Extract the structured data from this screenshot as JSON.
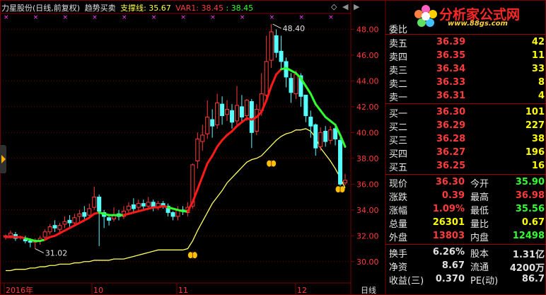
{
  "header": {
    "stock_name": "力星股份(日线,前复权)",
    "indicator_name": "趋势买卖",
    "support_label": "支撑线: 35.67",
    "var1_label": "VAR1: 38.45",
    "var2_label": ": 38.45"
  },
  "controls": {
    "diamond": "◇",
    "left_arrow": "◀",
    "right_arrow": "▶",
    "tab_label": "委比"
  },
  "logo": {
    "title": "分析家公式网",
    "url": "www.88gs.com"
  },
  "price_axis": {
    "ticks": [
      "48.00",
      "46.00",
      "44.00",
      "42.00",
      "40.00",
      "38.00",
      "36.00",
      "34.00",
      "32.00",
      "30.00"
    ],
    "values": [
      48,
      46,
      44,
      42,
      40,
      38,
      36,
      34,
      32,
      30
    ]
  },
  "date_axis": {
    "labels": [
      "2016年",
      "10",
      "11",
      "12"
    ],
    "period_label": "日线"
  },
  "annotations": {
    "high_label": "48.40",
    "low_label": "31.02"
  },
  "chart_data": {
    "type": "candlestick",
    "ylim": [
      29,
      49.5
    ],
    "candles": [
      [
        31.9,
        32.0,
        31.7,
        32.1
      ],
      [
        32.0,
        32.2,
        31.8,
        32.4
      ],
      [
        32.1,
        31.8,
        31.6,
        32.3
      ],
      [
        31.9,
        31.9,
        31.7,
        32.0
      ],
      [
        31.8,
        31.6,
        31.4,
        32.0
      ],
      [
        31.6,
        31.5,
        31.1,
        31.7
      ],
      [
        31.5,
        31.6,
        31.0,
        31.8
      ],
      [
        31.6,
        31.8,
        31.3,
        32.0
      ],
      [
        31.9,
        32.3,
        31.8,
        32.5
      ],
      [
        32.3,
        32.7,
        32.1,
        32.9
      ],
      [
        32.8,
        32.6,
        32.3,
        33.2
      ],
      [
        32.5,
        32.8,
        32.3,
        33.0
      ],
      [
        32.9,
        33.1,
        32.6,
        33.5
      ],
      [
        33.2,
        33.0,
        32.7,
        33.6
      ],
      [
        33.0,
        33.4,
        32.8,
        33.7
      ],
      [
        33.5,
        33.7,
        33.1,
        34.0
      ],
      [
        33.8,
        33.5,
        33.2,
        34.3
      ],
      [
        33.6,
        34.1,
        33.4,
        34.5
      ],
      [
        34.2,
        35.0,
        34.0,
        35.8
      ],
      [
        35.0,
        33.9,
        31.2,
        35.2
      ],
      [
        33.8,
        33.5,
        32.6,
        34.0
      ],
      [
        33.4,
        33.2,
        32.8,
        33.7
      ],
      [
        33.3,
        33.6,
        33.1,
        34.2
      ],
      [
        33.7,
        33.5,
        33.2,
        34.0
      ],
      [
        33.5,
        33.9,
        33.3,
        34.3
      ],
      [
        34.0,
        34.3,
        33.8,
        34.6
      ],
      [
        34.4,
        34.1,
        33.8,
        34.9
      ],
      [
        34.2,
        34.5,
        33.9,
        34.8
      ],
      [
        34.5,
        34.3,
        34.0,
        34.8
      ],
      [
        34.3,
        34.6,
        34.0,
        35.0
      ],
      [
        34.6,
        34.2,
        33.9,
        34.8
      ],
      [
        34.2,
        34.5,
        34.0,
        34.7
      ],
      [
        34.5,
        34.3,
        34.1,
        34.7
      ],
      [
        34.3,
        33.8,
        33.5,
        34.5
      ],
      [
        33.8,
        33.5,
        33.2,
        33.9
      ],
      [
        33.5,
        34.0,
        33.2,
        34.3
      ],
      [
        34.0,
        33.9,
        33.6,
        34.3
      ],
      [
        33.8,
        34.2,
        33.5,
        34.6
      ],
      [
        34.3,
        37.5,
        34.1,
        37.6
      ],
      [
        37.8,
        39.5,
        37.2,
        40.0
      ],
      [
        39.3,
        39.8,
        38.6,
        40.6
      ],
      [
        39.9,
        41.2,
        39.5,
        42.5
      ],
      [
        41.0,
        40.5,
        39.6,
        41.8
      ],
      [
        40.6,
        42.3,
        40.3,
        43.0
      ],
      [
        42.2,
        41.3,
        40.6,
        42.8
      ],
      [
        41.4,
        41.8,
        40.9,
        42.5
      ],
      [
        41.7,
        40.8,
        40.3,
        42.2
      ],
      [
        40.9,
        42.1,
        40.5,
        43.6
      ],
      [
        42.0,
        41.2,
        40.8,
        42.9
      ],
      [
        41.3,
        42.5,
        40.9,
        42.6
      ],
      [
        42.4,
        40.0,
        38.8,
        42.6
      ],
      [
        40.1,
        41.8,
        39.8,
        42.2
      ],
      [
        41.7,
        43.0,
        41.3,
        44.6
      ],
      [
        42.9,
        45.5,
        42.5,
        47.5
      ],
      [
        45.6,
        47.8,
        45.0,
        48.4
      ],
      [
        47.5,
        46.2,
        45.8,
        48.0
      ],
      [
        46.3,
        45.5,
        44.9,
        47.5
      ],
      [
        45.5,
        44.3,
        43.5,
        45.8
      ],
      [
        44.2,
        43.1,
        42.3,
        44.6
      ],
      [
        43.0,
        44.5,
        42.6,
        44.8
      ],
      [
        44.4,
        42.8,
        42.0,
        44.6
      ],
      [
        42.9,
        41.3,
        40.8,
        42.8
      ],
      [
        41.2,
        40.5,
        39.6,
        41.7
      ],
      [
        40.6,
        38.8,
        38.2,
        40.7
      ],
      [
        38.9,
        40.0,
        38.6,
        40.4
      ],
      [
        40.1,
        39.3,
        38.9,
        40.5
      ],
      [
        39.4,
        40.2,
        39.1,
        40.5
      ],
      [
        40.3,
        39.5,
        39.0,
        40.7
      ],
      [
        39.4,
        36.0,
        35.6,
        39.6
      ],
      [
        36.1,
        36.3,
        35.9,
        36.8
      ]
    ],
    "trend_line": [
      31.9,
      31.9,
      31.9,
      31.9,
      31.8,
      31.7,
      31.6,
      31.6,
      31.7,
      31.9,
      32.0,
      32.2,
      32.4,
      32.6,
      32.8,
      33.0,
      33.2,
      33.4,
      33.7,
      33.8,
      33.7,
      33.6,
      33.6,
      33.6,
      33.6,
      33.7,
      33.8,
      33.9,
      34.0,
      34.1,
      34.2,
      34.2,
      34.3,
      34.2,
      34.1,
      34.0,
      33.9,
      33.9,
      34.6,
      35.6,
      36.6,
      37.6,
      38.2,
      38.9,
      39.4,
      39.8,
      40.1,
      40.5,
      40.8,
      41.1,
      41.0,
      41.2,
      41.6,
      42.5,
      43.6,
      44.5,
      44.9,
      45.0,
      44.8,
      44.6,
      44.2,
      43.6,
      43.0,
      42.2,
      41.7,
      41.2,
      40.9,
      40.6,
      39.8,
      38.9
    ],
    "trend_colors": [
      "red",
      "red",
      "red",
      "red",
      "green",
      "green",
      "green",
      "green",
      "red",
      "red",
      "red",
      "red",
      "red",
      "red",
      "red",
      "red",
      "red",
      "red",
      "red",
      "green",
      "green",
      "green",
      "green",
      "green",
      "red",
      "red",
      "red",
      "red",
      "red",
      "red",
      "red",
      "red",
      "red",
      "green",
      "green",
      "green",
      "green",
      "red",
      "red",
      "red",
      "red",
      "red",
      "red",
      "red",
      "red",
      "red",
      "red",
      "red",
      "red",
      "red",
      "red",
      "red",
      "red",
      "red",
      "red",
      "red",
      "green",
      "green",
      "green",
      "green",
      "green",
      "green",
      "green",
      "green",
      "green",
      "green",
      "green",
      "green",
      "green",
      "green"
    ],
    "support_line": [
      29.3,
      29.3,
      29.4,
      29.4,
      29.4,
      29.5,
      29.5,
      29.6,
      29.6,
      29.7,
      29.7,
      29.8,
      29.8,
      29.8,
      29.9,
      29.9,
      30.0,
      30.0,
      30.1,
      30.1,
      30.1,
      30.1,
      30.2,
      30.2,
      30.2,
      30.3,
      30.4,
      30.5,
      30.6,
      30.7,
      30.8,
      30.9,
      30.9,
      30.9,
      30.9,
      30.9,
      30.9,
      31.0,
      31.6,
      32.4,
      33.1,
      33.8,
      34.5,
      35.0,
      35.5,
      36.1,
      36.5,
      36.9,
      37.3,
      37.7,
      37.9,
      38.0,
      38.2,
      38.6,
      39.0,
      39.4,
      39.7,
      39.9,
      40.0,
      40.2,
      40.2,
      40.3,
      40.1,
      39.6,
      38.8,
      38.3,
      37.8,
      37.2,
      36.5,
      35.7
    ],
    "butterflies": [
      {
        "index": 38,
        "price": 30.5
      },
      {
        "index": 54,
        "price": 37.6
      },
      {
        "index": 68,
        "price": 35.6
      }
    ],
    "colors": {
      "up": "#ff3b3b",
      "down": "#54ffff",
      "trend_up": "#ff1a1a",
      "trend_down": "#30ff30",
      "support": "#ffff60",
      "grid": "#7a0000"
    }
  },
  "quote": {
    "order_book": [
      {
        "label": "卖五",
        "price": "36.39",
        "volume": "42"
      },
      {
        "label": "卖四",
        "price": "36.35",
        "volume": "11"
      },
      {
        "label": "卖三",
        "price": "36.34",
        "volume": "33"
      },
      {
        "label": "卖二",
        "price": "36.33",
        "volume": "8"
      },
      {
        "label": "卖一",
        "price": "36.31",
        "volume": "4"
      },
      {
        "label": "买一",
        "price": "36.30",
        "volume": "101"
      },
      {
        "label": "买二",
        "price": "36.29",
        "volume": "227"
      },
      {
        "label": "买三",
        "price": "36.28",
        "volume": "38"
      },
      {
        "label": "买四",
        "price": "36.27",
        "volume": "196"
      },
      {
        "label": "买五",
        "price": "36.25",
        "volume": "16"
      }
    ],
    "stats": [
      {
        "l1": "现价",
        "v1": "36.30",
        "c1": "red",
        "l2": "今开",
        "v2": "35.90",
        "c2": "green"
      },
      {
        "l1": "涨跌",
        "v1": "0.39",
        "c1": "red",
        "l2": "最高",
        "v2": "36.98",
        "c2": "red"
      },
      {
        "l1": "涨幅",
        "v1": "1.09%",
        "c1": "red",
        "l2": "最低",
        "v2": "35.56",
        "c2": "green"
      },
      {
        "l1": "总量",
        "v1": "26301",
        "c1": "yellow",
        "l2": "量比",
        "v2": "0.67",
        "c2": "yellow"
      },
      {
        "l1": "外盘",
        "v1": "13803",
        "c1": "red",
        "l2": "内盘",
        "v2": "12498",
        "c2": "green"
      }
    ],
    "fundamentals": [
      {
        "l1": "换手",
        "v1": "6.26%",
        "l2": "股本",
        "v2": "1.31亿"
      },
      {
        "l1": "净资",
        "v1": "8.67",
        "l2": "流通",
        "v2": "4200万"
      },
      {
        "l1": "收益(三)",
        "v1": "0.370",
        "l2": "PE(动)",
        "v2": "86.7"
      }
    ]
  }
}
